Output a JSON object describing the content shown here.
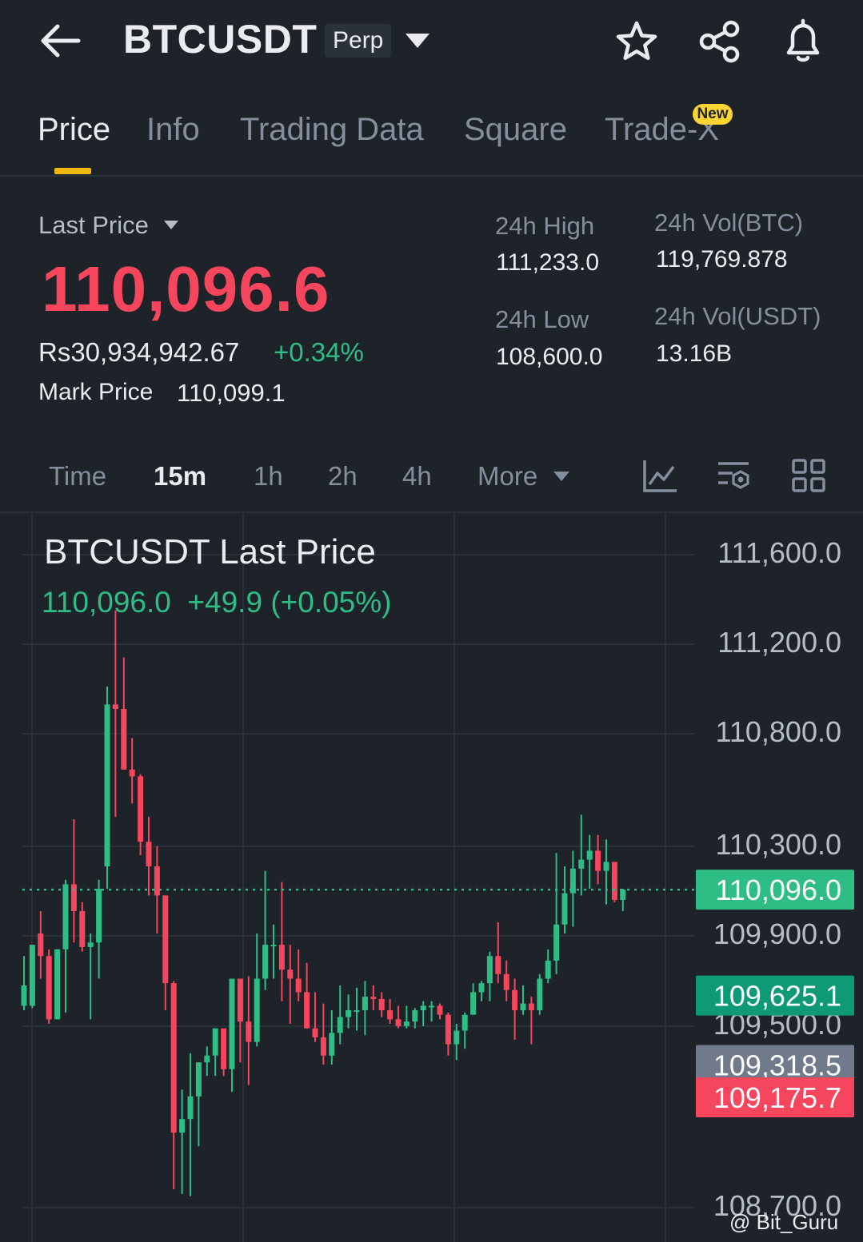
{
  "header": {
    "symbol": "BTCUSDT",
    "contract_type": "Perp",
    "icons": [
      "back-arrow-icon",
      "dropdown-caret-icon",
      "star-icon",
      "share-icon",
      "bell-icon"
    ]
  },
  "tabs": [
    {
      "label": "Price",
      "active": true
    },
    {
      "label": "Info",
      "active": false
    },
    {
      "label": "Trading Data",
      "active": false
    },
    {
      "label": "Square",
      "active": false
    },
    {
      "label": "Trade-X",
      "active": false,
      "badge": "New"
    }
  ],
  "ticker": {
    "last_price_label": "Last Price",
    "last_price": "110,096.6",
    "fiat_value": "Rs30,934,942.67",
    "change_pct": "+0.34%",
    "mark_price_label": "Mark Price",
    "mark_price": "110,099.1",
    "stats": {
      "high_label": "24h High",
      "high": "111,233.0",
      "low_label": "24h Low",
      "low": "108,600.0",
      "vol_btc_label": "24h Vol(BTC)",
      "vol_btc": "119,769.878",
      "vol_usdt_label": "24h Vol(USDT)",
      "vol_usdt": "13.16B"
    }
  },
  "intervals": {
    "items": [
      {
        "label": "Time",
        "active": false
      },
      {
        "label": "15m",
        "active": true
      },
      {
        "label": "1h",
        "active": false
      },
      {
        "label": "2h",
        "active": false
      },
      {
        "label": "4h",
        "active": false
      }
    ],
    "more_label": "More",
    "tool_icons": [
      "indicator-chart-icon",
      "chart-settings-icon",
      "grid-layout-icon"
    ]
  },
  "chart_data": {
    "type": "candlestick",
    "title": "BTCUSDT Last Price",
    "current_value": "110,096.0",
    "change": "+49.9 (+0.05%)",
    "y_axis_ticks": [
      "111,600.0",
      "111,200.0",
      "110,800.0",
      "110,300.0",
      "109,900.0",
      "109,500.0",
      "108,700.0"
    ],
    "price_tags": [
      {
        "label": "110,096.0",
        "value": 110096.0,
        "color": "#2ebd85"
      },
      {
        "label": "109,625.1",
        "value": 109625.1,
        "color": "#0f9a77"
      },
      {
        "label": "109,318.5",
        "value": 109318.5,
        "color": "#707a8a"
      },
      {
        "label": "109,175.7",
        "value": 109175.7,
        "color": "#f6465d"
      }
    ],
    "grid": true,
    "colors": {
      "up": "#2ebd85",
      "down": "#f6465d"
    },
    "candles": [
      {
        "o": 109580,
        "h": 109800,
        "l": 109560,
        "c": 109670
      },
      {
        "o": 109580,
        "h": 109850,
        "l": 109570,
        "c": 109850
      },
      {
        "o": 109900,
        "h": 110000,
        "l": 109700,
        "c": 109800
      },
      {
        "o": 109800,
        "h": 109830,
        "l": 109500,
        "c": 109520
      },
      {
        "o": 109520,
        "h": 109830,
        "l": 109520,
        "c": 109830
      },
      {
        "o": 109830,
        "h": 110140,
        "l": 109550,
        "c": 110120
      },
      {
        "o": 110120,
        "h": 110410,
        "l": 109860,
        "c": 110000
      },
      {
        "o": 110000,
        "h": 110040,
        "l": 109820,
        "c": 109840
      },
      {
        "o": 109840,
        "h": 109900,
        "l": 109520,
        "c": 109860
      },
      {
        "o": 109860,
        "h": 110140,
        "l": 109700,
        "c": 110100
      },
      {
        "o": 110200,
        "h": 111000,
        "l": 110100,
        "c": 110920
      },
      {
        "o": 110920,
        "h": 111340,
        "l": 110420,
        "c": 110900
      },
      {
        "o": 110900,
        "h": 111130,
        "l": 110800,
        "c": 110630
      },
      {
        "o": 110630,
        "h": 110770,
        "l": 110480,
        "c": 110600
      },
      {
        "o": 110600,
        "h": 110610,
        "l": 110250,
        "c": 110310
      },
      {
        "o": 110310,
        "h": 110420,
        "l": 110070,
        "c": 110200
      },
      {
        "o": 110200,
        "h": 110290,
        "l": 109900,
        "c": 110070
      },
      {
        "o": 110070,
        "h": 110070,
        "l": 109560,
        "c": 109680
      },
      {
        "o": 109680,
        "h": 109690,
        "l": 108770,
        "c": 109020
      },
      {
        "o": 109020,
        "h": 109210,
        "l": 108750,
        "c": 109080
      },
      {
        "o": 109080,
        "h": 109370,
        "l": 108740,
        "c": 109180
      },
      {
        "o": 109180,
        "h": 109330,
        "l": 108960,
        "c": 109330
      },
      {
        "o": 109330,
        "h": 109400,
        "l": 109270,
        "c": 109360
      },
      {
        "o": 109360,
        "h": 109480,
        "l": 109270,
        "c": 109480
      },
      {
        "o": 109480,
        "h": 109350,
        "l": 109270,
        "c": 109300
      },
      {
        "o": 109300,
        "h": 109700,
        "l": 109200,
        "c": 109700
      },
      {
        "o": 109700,
        "h": 109700,
        "l": 109330,
        "c": 109510
      },
      {
        "o": 109510,
        "h": 109710,
        "l": 109230,
        "c": 109420
      },
      {
        "o": 109420,
        "h": 109900,
        "l": 109400,
        "c": 109700
      },
      {
        "o": 109700,
        "h": 110180,
        "l": 109650,
        "c": 109850
      },
      {
        "o": 109850,
        "h": 109940,
        "l": 109700,
        "c": 109850
      },
      {
        "o": 109850,
        "h": 110130,
        "l": 109600,
        "c": 109740
      },
      {
        "o": 109740,
        "h": 109850,
        "l": 109500,
        "c": 109700
      },
      {
        "o": 109700,
        "h": 109830,
        "l": 109600,
        "c": 109640
      },
      {
        "o": 109640,
        "h": 109770,
        "l": 109480,
        "c": 109480
      },
      {
        "o": 109480,
        "h": 109640,
        "l": 109420,
        "c": 109440
      },
      {
        "o": 109440,
        "h": 109590,
        "l": 109320,
        "c": 109360
      },
      {
        "o": 109360,
        "h": 109560,
        "l": 109320,
        "c": 109460
      },
      {
        "o": 109460,
        "h": 109670,
        "l": 109410,
        "c": 109530
      },
      {
        "o": 109530,
        "h": 109630,
        "l": 109480,
        "c": 109560
      },
      {
        "o": 109560,
        "h": 109660,
        "l": 109470,
        "c": 109560
      },
      {
        "o": 109560,
        "h": 109690,
        "l": 109450,
        "c": 109620
      },
      {
        "o": 109620,
        "h": 109670,
        "l": 109560,
        "c": 109610
      },
      {
        "o": 109610,
        "h": 109640,
        "l": 109530,
        "c": 109560
      },
      {
        "o": 109560,
        "h": 109610,
        "l": 109500,
        "c": 109520
      },
      {
        "o": 109520,
        "h": 109580,
        "l": 109480,
        "c": 109490
      },
      {
        "o": 109490,
        "h": 109580,
        "l": 109480,
        "c": 109510
      },
      {
        "o": 109510,
        "h": 109570,
        "l": 109480,
        "c": 109560
      },
      {
        "o": 109560,
        "h": 109600,
        "l": 109490,
        "c": 109580
      },
      {
        "o": 109580,
        "h": 109600,
        "l": 109510,
        "c": 109580
      },
      {
        "o": 109580,
        "h": 109590,
        "l": 109520,
        "c": 109540
      },
      {
        "o": 109540,
        "h": 109550,
        "l": 109360,
        "c": 109410
      },
      {
        "o": 109410,
        "h": 109500,
        "l": 109340,
        "c": 109470
      },
      {
        "o": 109470,
        "h": 109550,
        "l": 109390,
        "c": 109540
      },
      {
        "o": 109540,
        "h": 109680,
        "l": 109540,
        "c": 109640
      },
      {
        "o": 109640,
        "h": 109690,
        "l": 109600,
        "c": 109680
      },
      {
        "o": 109680,
        "h": 109820,
        "l": 109600,
        "c": 109800
      },
      {
        "o": 109800,
        "h": 109950,
        "l": 109680,
        "c": 109720
      },
      {
        "o": 109720,
        "h": 109780,
        "l": 109600,
        "c": 109650
      },
      {
        "o": 109650,
        "h": 109700,
        "l": 109430,
        "c": 109560
      },
      {
        "o": 109560,
        "h": 109670,
        "l": 109540,
        "c": 109590
      },
      {
        "o": 109590,
        "h": 109620,
        "l": 109410,
        "c": 109560
      },
      {
        "o": 109560,
        "h": 109720,
        "l": 109540,
        "c": 109700
      },
      {
        "o": 109700,
        "h": 109830,
        "l": 109680,
        "c": 109780
      },
      {
        "o": 109780,
        "h": 110260,
        "l": 109720,
        "c": 109940
      },
      {
        "o": 109940,
        "h": 110200,
        "l": 109900,
        "c": 110080
      },
      {
        "o": 110080,
        "h": 110270,
        "l": 109930,
        "c": 110190
      },
      {
        "o": 110190,
        "h": 110430,
        "l": 110070,
        "c": 110230
      },
      {
        "o": 110230,
        "h": 110340,
        "l": 110100,
        "c": 110270
      },
      {
        "o": 110270,
        "h": 110340,
        "l": 110120,
        "c": 110180
      },
      {
        "o": 110180,
        "h": 110320,
        "l": 110030,
        "c": 110220
      },
      {
        "o": 110220,
        "h": 110220,
        "l": 110040,
        "c": 110050
      },
      {
        "o": 110050,
        "h": 110100,
        "l": 110000,
        "c": 110096
      }
    ]
  },
  "watermark": "@ Bit_Guru"
}
